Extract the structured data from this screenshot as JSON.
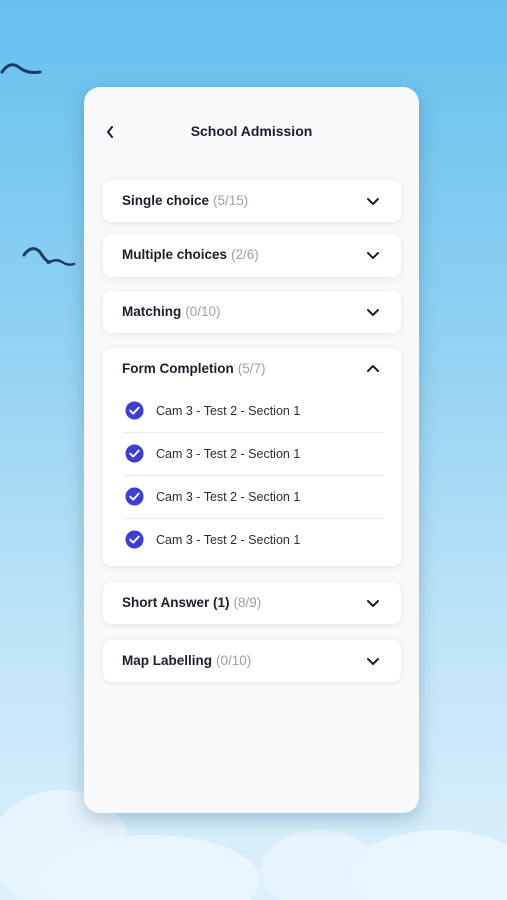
{
  "header": {
    "title": "School Admission"
  },
  "sections": [
    {
      "label": "Single choice",
      "count": "(5/15)",
      "expanded": false
    },
    {
      "label": "Multiple choices",
      "count": "(2/6)",
      "expanded": false
    },
    {
      "label": "Matching",
      "count": "(0/10)",
      "expanded": false
    },
    {
      "label": "Form Completion",
      "count": "(5/7)",
      "expanded": true,
      "items": [
        {
          "label": "Cam 3 - Test 2 - Section 1",
          "checked": true
        },
        {
          "label": "Cam 3 - Test 2 - Section 1",
          "checked": true
        },
        {
          "label": "Cam 3 - Test 2 - Section 1",
          "checked": true
        },
        {
          "label": "Cam 3 - Test 2 - Section 1",
          "checked": true
        }
      ]
    },
    {
      "label": "Short Answer (1)",
      "count": "(8/9)",
      "expanded": false
    },
    {
      "label": "Map Labelling",
      "count": "(0/10)",
      "expanded": false
    }
  ],
  "icons": {
    "back": "chevron-left-icon",
    "expand": "chevron-down-icon",
    "collapse": "chevron-up-icon",
    "check": "check-circle-icon"
  },
  "colors": {
    "accent": "#3f3dd2",
    "text": "#1b1e2b",
    "muted": "#9aa0ac",
    "card": "#f8f9fb",
    "sky_top": "#66c0ee",
    "sky_bottom": "#dcf0fb"
  }
}
